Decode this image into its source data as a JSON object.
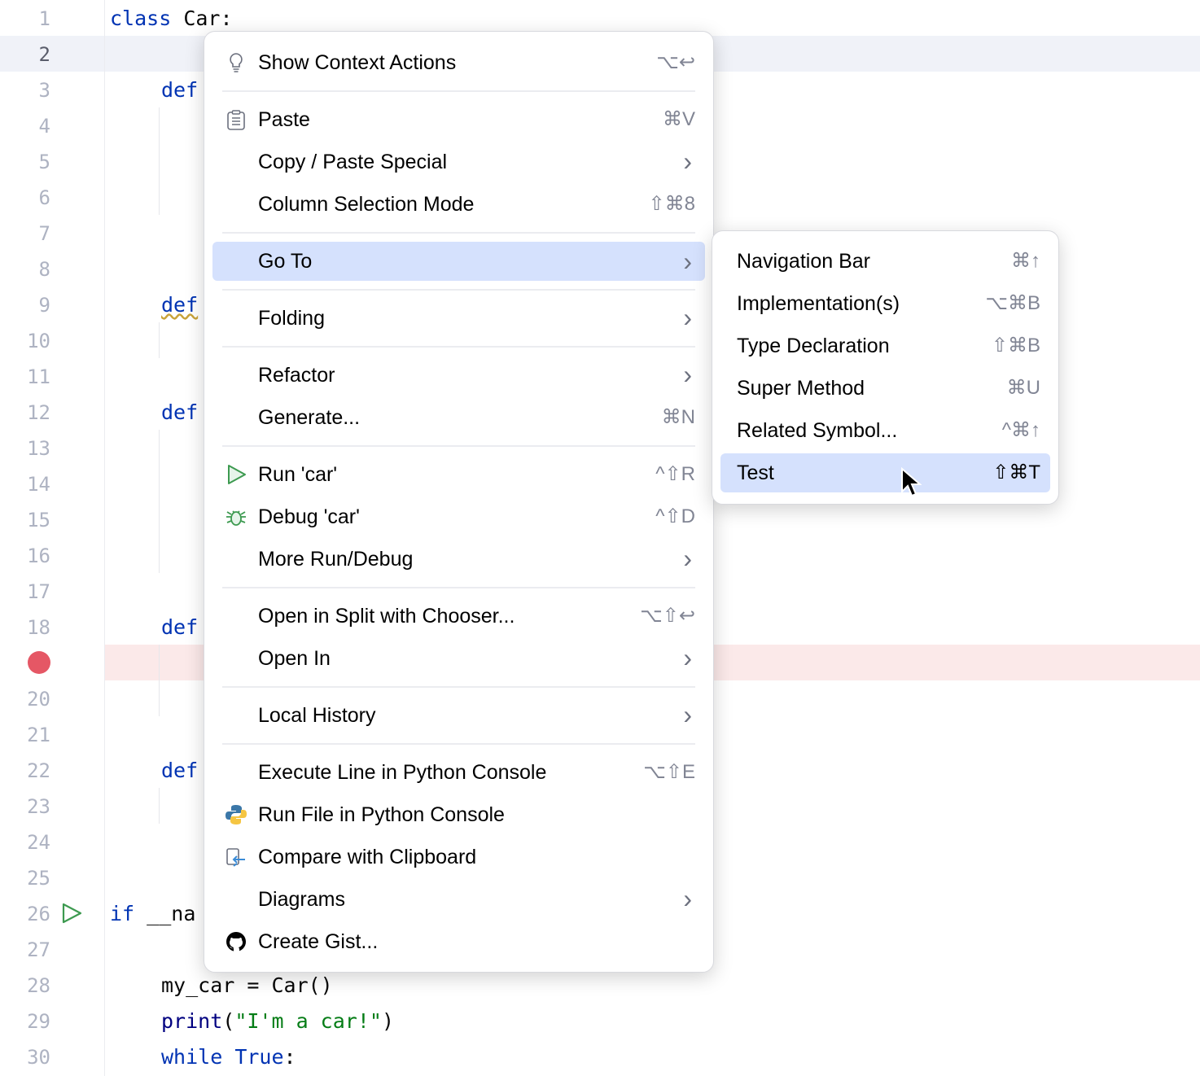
{
  "editor": {
    "line_numbers": [
      "1",
      "2",
      "3",
      "4",
      "5",
      "6",
      "7",
      "8",
      "9",
      "10",
      "11",
      "12",
      "13",
      "14",
      "15",
      "16",
      "17",
      "18",
      "",
      "20",
      "21",
      "22",
      "23",
      "24",
      "25",
      "26",
      "27",
      "28",
      "29",
      "30"
    ],
    "code": {
      "l1_kw": "class",
      "l1_rest": " Car:",
      "def_kw": "def",
      "l26_kw": "if",
      "l26_rest": " __na",
      "l28": "my_car = Car()",
      "l29_fn": "print",
      "l29_open": "(",
      "l29_str": "\"I'm a car!\"",
      "l29_close": ")",
      "l30_kw1": "while",
      "l30_kw2": "True",
      "l30_rest": ":"
    },
    "current_line": 2,
    "breakpoint_line": 19,
    "colors": {
      "keyword": "#0033b3",
      "string": "#067d17",
      "selection": "#d5e1fd",
      "breakpoint": "#e55765",
      "run": "#3d9a50"
    }
  },
  "context_menu": {
    "items": [
      {
        "label": "Show Context Actions",
        "shortcut": "⌥↩",
        "icon": "lightbulb-icon"
      },
      {
        "label": "Paste",
        "shortcut": "⌘V",
        "icon": "clipboard-icon"
      },
      {
        "label": "Copy / Paste Special",
        "shortcut": "›"
      },
      {
        "label": "Column Selection Mode",
        "shortcut": "⇧⌘8"
      },
      {
        "label": "Go To",
        "shortcut": "›",
        "selected": true
      },
      {
        "label": "Folding",
        "shortcut": "›"
      },
      {
        "label": "Refactor",
        "shortcut": "›"
      },
      {
        "label": "Generate...",
        "shortcut": "⌘N"
      },
      {
        "label": "Run 'car'",
        "shortcut": "^⇧R",
        "icon": "run-icon"
      },
      {
        "label": "Debug 'car'",
        "shortcut": "^⇧D",
        "icon": "bug-icon"
      },
      {
        "label": "More Run/Debug",
        "shortcut": "›"
      },
      {
        "label": "Open in Split with Chooser...",
        "shortcut": "⌥⇧↩"
      },
      {
        "label": "Open In",
        "shortcut": "›"
      },
      {
        "label": "Local History",
        "shortcut": "›"
      },
      {
        "label": "Execute Line in Python Console",
        "shortcut": "⌥⇧E"
      },
      {
        "label": "Run File in Python Console",
        "shortcut": "",
        "icon": "python-icon"
      },
      {
        "label": "Compare with Clipboard",
        "shortcut": "",
        "icon": "compare-icon"
      },
      {
        "label": "Diagrams",
        "shortcut": "›"
      },
      {
        "label": "Create Gist...",
        "shortcut": "",
        "icon": "github-icon"
      }
    ]
  },
  "submenu": {
    "items": [
      {
        "label": "Navigation Bar",
        "shortcut": "⌘↑"
      },
      {
        "label": "Implementation(s)",
        "shortcut": "⌥⌘B"
      },
      {
        "label": "Type Declaration",
        "shortcut": "⇧⌘B"
      },
      {
        "label": "Super Method",
        "shortcut": "⌘U"
      },
      {
        "label": "Related Symbol...",
        "shortcut": "^⌘↑"
      },
      {
        "label": "Test",
        "shortcut": "⇧⌘T",
        "selected": true
      }
    ]
  }
}
